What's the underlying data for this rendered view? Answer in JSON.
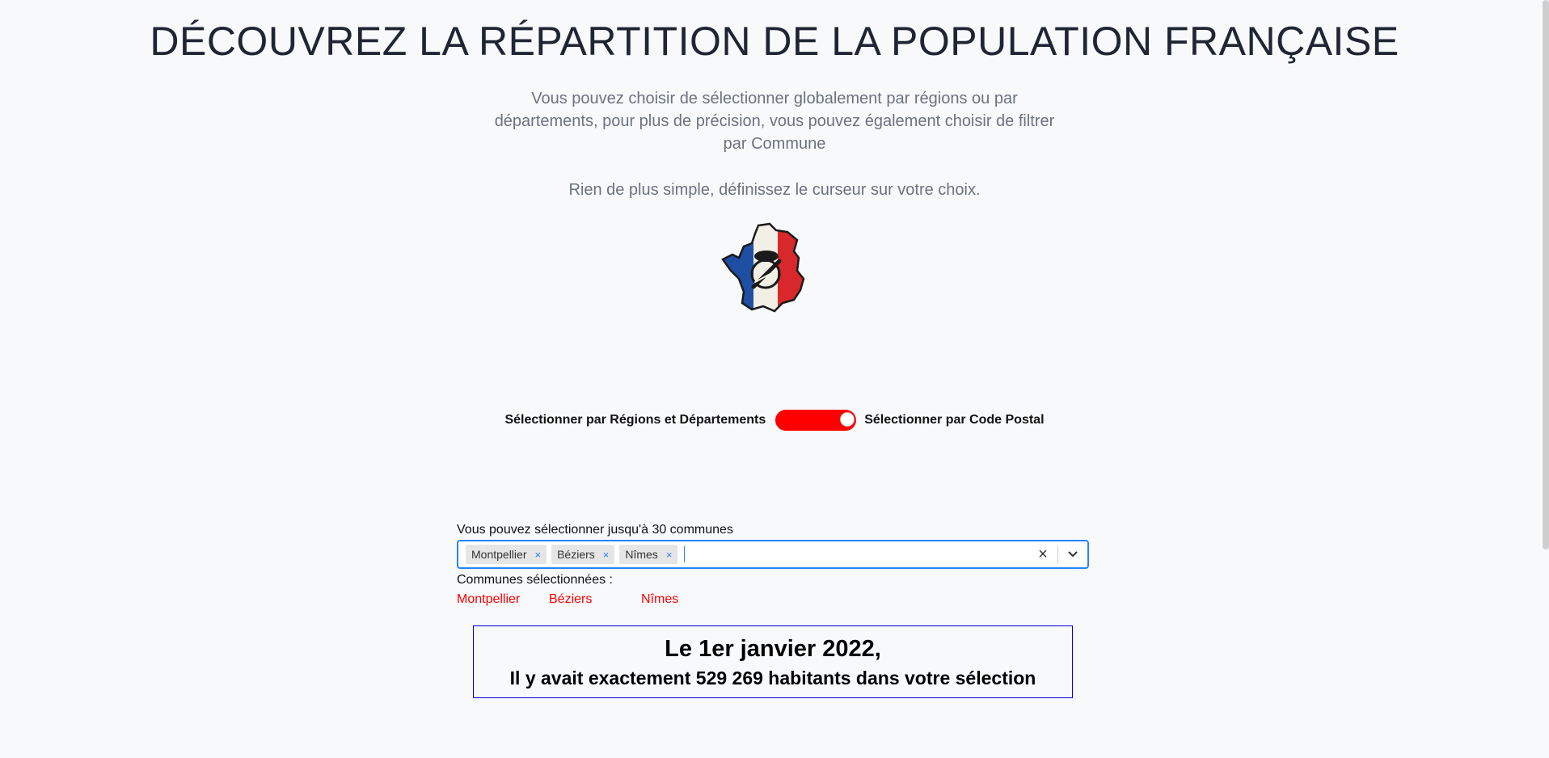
{
  "page": {
    "title": "DÉCOUVREZ LA RÉPARTITION DE LA POPULATION FRANÇAISE",
    "intro": "Vous pouvez choisir de sélectionner globalement par régions ou par départements, pour plus de précision, vous pouvez également choisir de filtrer par Commune",
    "intro2": "Rien de plus simple, définissez le curseur sur votre choix."
  },
  "logo": {
    "icon": "france-map-beret-baguette-logo"
  },
  "toggle": {
    "left_label": "Sélectionner par Régions et Départements",
    "right_label": "Sélectionner par Code Postal",
    "state": "code-postal",
    "color": "#ff0000"
  },
  "select": {
    "label": "Vous pouvez sélectionner jusqu'à 30 communes",
    "tags": [
      "Montpellier",
      "Béziers",
      "Nîmes"
    ],
    "remove_icon": "×",
    "clear_icon": "×",
    "dropdown_icon": "chevron-down-icon",
    "focus_color": "#2684ff"
  },
  "selected": {
    "heading": "Communes sélectionnées :",
    "items": [
      "Montpellier",
      "Béziers",
      "Nîmes"
    ],
    "color": "#ff0000"
  },
  "result": {
    "line1": "Le 1er janvier 2022,",
    "line2": "Il y avait exactement 529 269 habitants dans votre sélection"
  }
}
